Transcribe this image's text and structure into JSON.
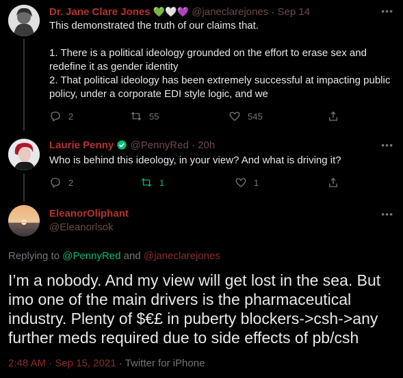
{
  "tweets": [
    {
      "name": "Dr. Jane Clare Jones",
      "handle": "@janeclarejones",
      "date": "Sep 14",
      "text": "This demonstrated the truth of our claims that.\n\n1. There is a political ideology grounded on the effort to erase sex and redefine it as gender identity\n2. That political ideology has been extremely successful at impacting public policy, under a corporate EDI style logic, and we",
      "replies": "2",
      "retweets": "55",
      "likes": "545",
      "hearts": [
        "💚",
        "🤍",
        "💜"
      ]
    },
    {
      "name": "Laurie Penny",
      "handle": "@PennyRed",
      "date": "20h",
      "text": "Who is behind this ideology, in your view? And what is driving it?",
      "replies": "2",
      "retweets": "1",
      "likes": "1"
    }
  ],
  "main": {
    "name": "EleanorOliphant",
    "handle": "@Eleanorlsok",
    "replying_prefix": "Replying to",
    "replying_to_1": "@PennyRed",
    "replying_and": "and",
    "replying_to_2": "@janeclarejones",
    "text": "I’m a nobody. And my view will get lost in the sea. But imo one of the main drivers is the pharmaceutical industry. Plenty of $€£ in puberty blockers->csh->any further meds required due to side effects of pb/csh",
    "time": "2:48 AM · Sep 15, 2021",
    "source": "Twitter for iPhone"
  },
  "colors": {
    "name": "#b6322f",
    "link": "#8b2c28",
    "retweeted": "#00ba7c",
    "verified": "#00ba7c"
  },
  "icons": [
    "reply-icon",
    "retweet-icon",
    "like-icon",
    "share-icon",
    "more-icon",
    "verified-icon"
  ]
}
